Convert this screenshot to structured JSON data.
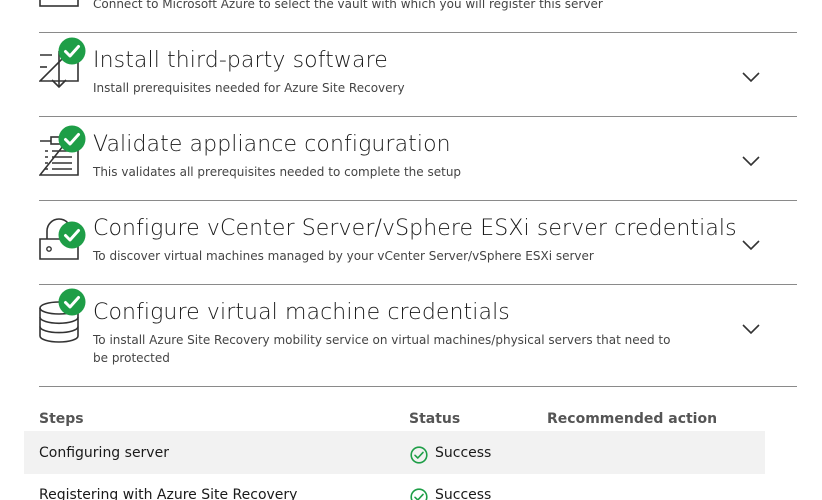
{
  "steps": [
    {
      "id": "connect-azure",
      "title": "",
      "description": "Connect to Microsoft Azure to select the vault with which you will register this server",
      "icon": "computer-icon",
      "status": "complete"
    },
    {
      "id": "third-party",
      "title": "Install third-party software",
      "description": "Install prerequisites needed for Azure Site Recovery",
      "icon": "download-icon",
      "status": "complete"
    },
    {
      "id": "validate",
      "title": "Validate appliance configuration",
      "description": "This validates all prerequisites needed to complete the setup",
      "icon": "checklist-icon",
      "status": "complete"
    },
    {
      "id": "vcenter",
      "title": "Configure vCenter Server/vSphere ESXi server credentials",
      "description": "To discover virtual machines managed by your vCenter Server/vSphere ESXi server",
      "icon": "credential-lock-icon",
      "status": "complete"
    },
    {
      "id": "vm-creds",
      "title": "Configure virtual machine credentials",
      "description": "To install Azure Site Recovery mobility service on virtual machines/physical servers that need to be protected",
      "icon": "database-icon",
      "status": "complete"
    }
  ],
  "table": {
    "headers": {
      "steps": "Steps",
      "status": "Status",
      "action": "Recommended action"
    },
    "rows": [
      {
        "step": "Configuring server",
        "status": "Success",
        "action": ""
      },
      {
        "step": "Registering with Azure Site Recovery",
        "status": "Success",
        "action": ""
      }
    ]
  },
  "colors": {
    "success_green": "#1e9e47",
    "divider": "#8a8a8a",
    "row_shade": "#f2f2f2"
  }
}
